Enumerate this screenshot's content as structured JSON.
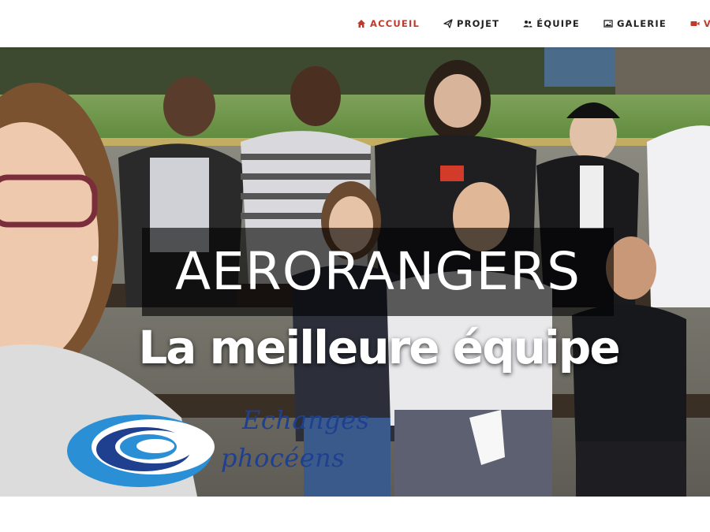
{
  "nav": {
    "items": [
      {
        "label": "ACCUEIL",
        "icon": "home-icon",
        "active": true
      },
      {
        "label": "PROJET",
        "icon": "paper-plane-icon",
        "active": false
      },
      {
        "label": "ÉQUIPE",
        "icon": "users-icon",
        "active": false
      },
      {
        "label": "GALERIE",
        "icon": "image-icon",
        "active": false
      },
      {
        "label": "VIDÉO",
        "icon": "video-camera-icon",
        "active": false
      }
    ],
    "active_color": "#c0392b"
  },
  "hero": {
    "title": "AERORANGERS",
    "subtitle": "La meilleure équipe"
  },
  "logo": {
    "line1": "Echanges",
    "line2": "phocéens",
    "color": "#1f3f8f",
    "swirl_color": "#2a8fd4"
  }
}
